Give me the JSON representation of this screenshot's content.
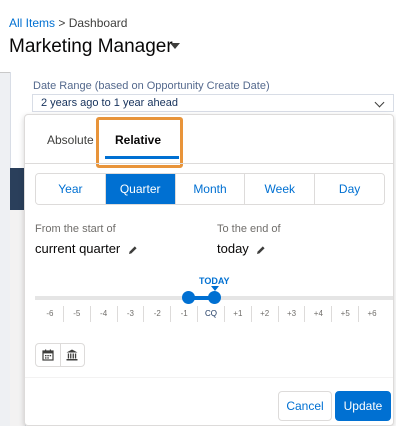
{
  "header": {
    "breadcrumb_link": "All Items",
    "breadcrumb_separator": ">",
    "breadcrumb_current": "Dashboard",
    "title": "Marketing Manager",
    "title_dropdown_icon": "caret-down-icon"
  },
  "date_range": {
    "label": "Date Range (based on Opportunity Create Date)",
    "value": "2 years ago to 1 year ahead",
    "chevron_icon": "chevron-down-icon"
  },
  "picker": {
    "tabs": [
      {
        "label": "Absolute",
        "selected": false
      },
      {
        "label": "Relative",
        "selected": true
      }
    ],
    "highlight_color": "#e8943a",
    "granularity": [
      {
        "label": "Year",
        "selected": false
      },
      {
        "label": "Quarter",
        "selected": true
      },
      {
        "label": "Month",
        "selected": false
      },
      {
        "label": "Week",
        "selected": false
      },
      {
        "label": "Day",
        "selected": false
      }
    ],
    "from_label": "From the start of",
    "from_value": "current quarter",
    "to_label": "To the end of",
    "to_value": "today",
    "edit_icon": "pencil-icon",
    "today_marker": "TODAY",
    "ticks": [
      "-6",
      "-5",
      "-4",
      "-3",
      "-2",
      "-1",
      "CQ",
      "+1",
      "+2",
      "+3",
      "+4",
      "+5",
      "+6"
    ],
    "icons": [
      "calendar-icon",
      "fiscal-building-icon"
    ],
    "cancel_label": "Cancel",
    "update_label": "Update"
  },
  "colors": {
    "accent": "#0070d2",
    "text": "#16325c"
  }
}
